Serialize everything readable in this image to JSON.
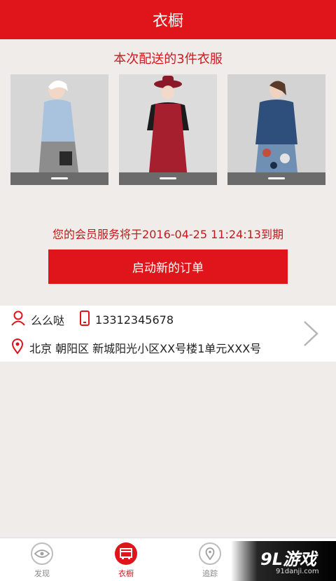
{
  "header": {
    "title": "衣橱"
  },
  "delivery": {
    "title": "本次配送的3件衣服",
    "items": [
      {
        "name": "garment-1"
      },
      {
        "name": "garment-2"
      },
      {
        "name": "garment-3"
      }
    ]
  },
  "membership": {
    "expiry_text": "您的会员服务将于2016-04-25 11:24:13到期",
    "start_order_label": "启动新的订单"
  },
  "address": {
    "name": "么么哒",
    "phone": "13312345678",
    "address_line": "北京 朝阳区 新城阳光小区XX号楼1单元XXX号"
  },
  "tabbar": {
    "tabs": [
      {
        "label": "发现",
        "icon": "eye-icon"
      },
      {
        "label": "衣橱",
        "icon": "wardrobe-icon",
        "active": true
      },
      {
        "label": "追踪",
        "icon": "location-icon"
      }
    ]
  },
  "watermark": {
    "main": "9L游戏",
    "sub": "91danji.com"
  },
  "colors": {
    "brand_red": "#e0151b",
    "background": "#efecea",
    "text_red": "#c8161c"
  }
}
